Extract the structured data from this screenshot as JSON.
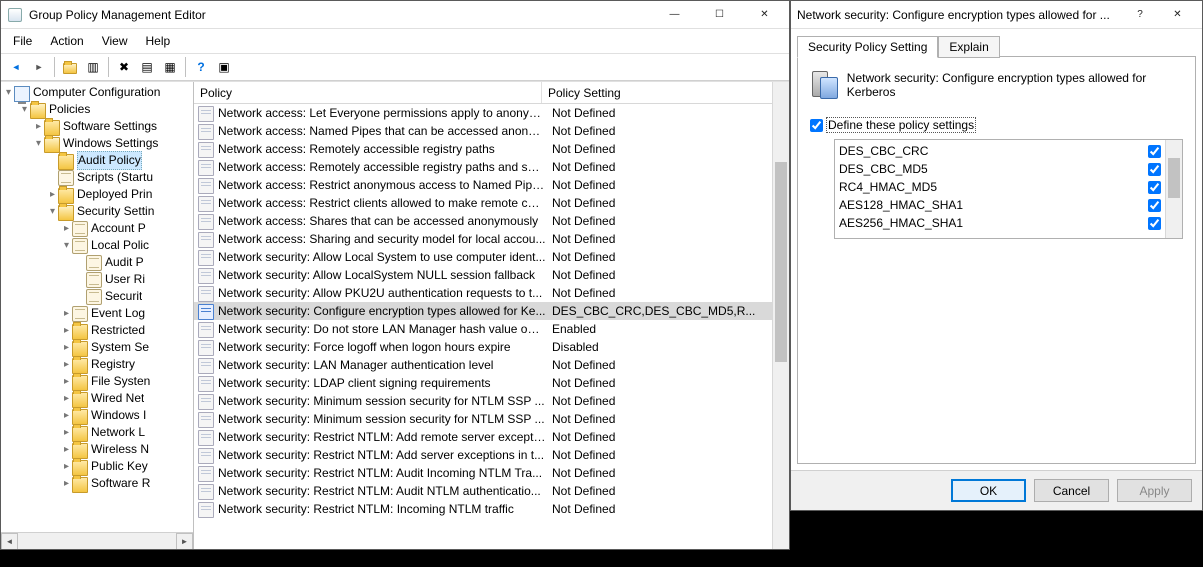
{
  "main": {
    "title": "Group Policy Management Editor",
    "menus": [
      "File",
      "Action",
      "View",
      "Help"
    ]
  },
  "tree": {
    "root": "Computer Configuration",
    "items": [
      {
        "label": "Policies",
        "depth": 1,
        "expanded": true,
        "icon": "folder-open"
      },
      {
        "label": "Software Settings",
        "depth": 2,
        "expanded": false,
        "icon": "folder"
      },
      {
        "label": "Windows Settings",
        "depth": 2,
        "expanded": true,
        "icon": "folder-open"
      },
      {
        "label": "Audit Policy",
        "depth": 3,
        "expanded": null,
        "icon": "folder",
        "selected": true
      },
      {
        "label": "Scripts (Startu",
        "depth": 3,
        "expanded": null,
        "icon": "scroll"
      },
      {
        "label": "Deployed Prin",
        "depth": 3,
        "expanded": false,
        "icon": "folder"
      },
      {
        "label": "Security Settin",
        "depth": 3,
        "expanded": true,
        "icon": "folder-open"
      },
      {
        "label": "Account P",
        "depth": 4,
        "expanded": false,
        "icon": "scroll"
      },
      {
        "label": "Local Polic",
        "depth": 4,
        "expanded": true,
        "icon": "scroll"
      },
      {
        "label": "Audit P",
        "depth": 5,
        "expanded": null,
        "icon": "scroll"
      },
      {
        "label": "User Ri",
        "depth": 5,
        "expanded": null,
        "icon": "scroll"
      },
      {
        "label": "Securit",
        "depth": 5,
        "expanded": null,
        "icon": "scroll"
      },
      {
        "label": "Event Log",
        "depth": 4,
        "expanded": false,
        "icon": "scroll"
      },
      {
        "label": "Restricted",
        "depth": 4,
        "expanded": false,
        "icon": "folder"
      },
      {
        "label": "System Se",
        "depth": 4,
        "expanded": false,
        "icon": "folder"
      },
      {
        "label": "Registry",
        "depth": 4,
        "expanded": false,
        "icon": "folder"
      },
      {
        "label": "File Systen",
        "depth": 4,
        "expanded": false,
        "icon": "folder"
      },
      {
        "label": "Wired Net",
        "depth": 4,
        "expanded": false,
        "icon": "folder"
      },
      {
        "label": "Windows I",
        "depth": 4,
        "expanded": false,
        "icon": "folder"
      },
      {
        "label": "Network L",
        "depth": 4,
        "expanded": false,
        "icon": "folder"
      },
      {
        "label": "Wireless N",
        "depth": 4,
        "expanded": false,
        "icon": "folder"
      },
      {
        "label": "Public Key",
        "depth": 4,
        "expanded": false,
        "icon": "folder"
      },
      {
        "label": "Software R",
        "depth": 4,
        "expanded": false,
        "icon": "folder"
      }
    ]
  },
  "list": {
    "headers": [
      "Policy",
      "Policy Setting"
    ],
    "rows": [
      {
        "p": "Network access: Let Everyone permissions apply to anonym...",
        "s": "Not Defined"
      },
      {
        "p": "Network access: Named Pipes that can be accessed anonym...",
        "s": "Not Defined"
      },
      {
        "p": "Network access: Remotely accessible registry paths",
        "s": "Not Defined"
      },
      {
        "p": "Network access: Remotely accessible registry paths and sub...",
        "s": "Not Defined"
      },
      {
        "p": "Network access: Restrict anonymous access to Named Pipes...",
        "s": "Not Defined"
      },
      {
        "p": "Network access: Restrict clients allowed to make remote call...",
        "s": "Not Defined"
      },
      {
        "p": "Network access: Shares that can be accessed anonymously",
        "s": "Not Defined"
      },
      {
        "p": "Network access: Sharing and security model for local accou...",
        "s": "Not Defined"
      },
      {
        "p": "Network security: Allow Local System to use computer ident...",
        "s": "Not Defined"
      },
      {
        "p": "Network security: Allow LocalSystem NULL session fallback",
        "s": "Not Defined"
      },
      {
        "p": "Network security: Allow PKU2U authentication requests to t...",
        "s": "Not Defined"
      },
      {
        "p": "Network security: Configure encryption types allowed for Ke...",
        "s": "DES_CBC_CRC,DES_CBC_MD5,R...",
        "selected": true
      },
      {
        "p": "Network security: Do not store LAN Manager hash value on ...",
        "s": "Enabled"
      },
      {
        "p": "Network security: Force logoff when logon hours expire",
        "s": "Disabled"
      },
      {
        "p": "Network security: LAN Manager authentication level",
        "s": "Not Defined"
      },
      {
        "p": "Network security: LDAP client signing requirements",
        "s": "Not Defined"
      },
      {
        "p": "Network security: Minimum session security for NTLM SSP ...",
        "s": "Not Defined"
      },
      {
        "p": "Network security: Minimum session security for NTLM SSP ...",
        "s": "Not Defined"
      },
      {
        "p": "Network security: Restrict NTLM: Add remote server excepti...",
        "s": "Not Defined"
      },
      {
        "p": "Network security: Restrict NTLM: Add server exceptions in t...",
        "s": "Not Defined"
      },
      {
        "p": "Network security: Restrict NTLM: Audit Incoming NTLM Tra...",
        "s": "Not Defined"
      },
      {
        "p": "Network security: Restrict NTLM: Audit NTLM authenticatio...",
        "s": "Not Defined"
      },
      {
        "p": "Network security: Restrict NTLM: Incoming NTLM traffic",
        "s": "Not Defined"
      }
    ]
  },
  "dialog": {
    "title": "Network security: Configure encryption types allowed for ...",
    "tabs": [
      "Security Policy Setting",
      "Explain"
    ],
    "heading": "Network security: Configure encryption types allowed for Kerberos",
    "define_label": "Define these policy settings",
    "define_checked": true,
    "enc_types": [
      {
        "label": "DES_CBC_CRC",
        "checked": true
      },
      {
        "label": "DES_CBC_MD5",
        "checked": true
      },
      {
        "label": "RC4_HMAC_MD5",
        "checked": true
      },
      {
        "label": "AES128_HMAC_SHA1",
        "checked": true
      },
      {
        "label": "AES256_HMAC_SHA1",
        "checked": true
      }
    ],
    "buttons": {
      "ok": "OK",
      "cancel": "Cancel",
      "apply": "Apply"
    }
  }
}
